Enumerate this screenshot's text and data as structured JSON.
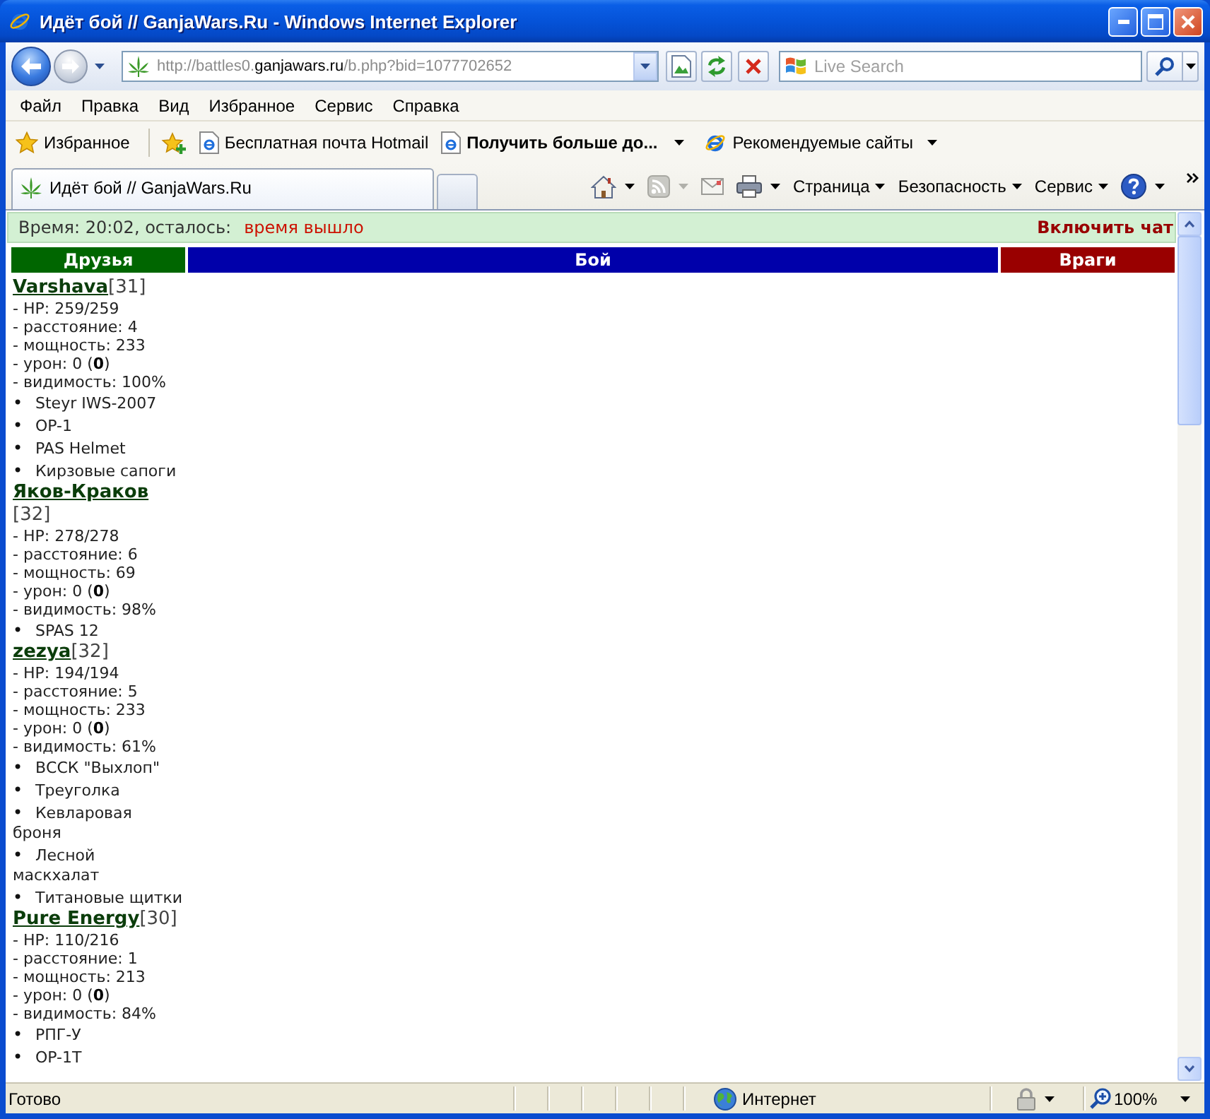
{
  "window": {
    "title": "Идёт бой // GanjaWars.Ru - Windows Internet Explorer"
  },
  "address_bar": {
    "url_start": "http://battles0.",
    "url_domain": "ganjawars.ru",
    "url_end": "/b.php?bid=1077702652"
  },
  "search": {
    "placeholder": "Live Search"
  },
  "menu": [
    "Файл",
    "Правка",
    "Вид",
    "Избранное",
    "Сервис",
    "Справка"
  ],
  "favorites_bar": {
    "favorites_label": "Избранное",
    "links": [
      {
        "kind": "link",
        "label": "Бесплатная почта Hotmail"
      },
      {
        "kind": "web_slice",
        "label": "Получить больше до..."
      },
      {
        "kind": "suggested",
        "label": "Рекомендуемые сайты"
      }
    ]
  },
  "tabs": [
    {
      "label": "Идёт бой // GanjaWars.Ru",
      "selected": true
    }
  ],
  "command_bar": {
    "feeds_disabled": true,
    "menus": [
      "Страница",
      "Безопасность",
      "Сервис"
    ]
  },
  "page": {
    "timer": {
      "label": "Время: 20:02, осталось:",
      "value": "время вышло"
    },
    "chat_link": "Включить чат",
    "columns": [
      {
        "label": "Друзья",
        "color": "#006600"
      },
      {
        "label": "Бой",
        "color": "#0000aa"
      },
      {
        "label": "Враги",
        "color": "#990000"
      }
    ],
    "friends": [
      {
        "name": "Varshava",
        "level": "[31]",
        "stats": [
          "- HP: 259/259",
          "- расстояние: 4",
          "- мощность: 233",
          "- урон: 0 (**0**)",
          "- видимость: 100%"
        ],
        "items": [
          {
            "marker": "•",
            "name": "Steyr IWS-2007"
          },
          {
            "marker": "•",
            "name": "OP-1"
          },
          {
            "marker": "•",
            "name": "PAS Helmet"
          },
          {
            "marker": "•",
            "name": "Кирзовые сапоги"
          }
        ]
      },
      {
        "name": "Яков-Краков",
        "level": "[32]",
        "stats": [
          "- HP: 278/278",
          "- расстояние: 6",
          "- мощность: 69",
          "- урон: 0 (**0**)",
          "- видимость: 98%"
        ],
        "items": [
          {
            "marker": "•",
            "name": "SPAS 12"
          }
        ]
      },
      {
        "name": "zezya",
        "level": "[32]",
        "stats": [
          "- HP: 194/194",
          "- расстояние: 5",
          "- мощность: 233",
          "- урон: 0 (**0**)",
          "- видимость: 61%"
        ],
        "items": [
          {
            "marker": "•",
            "name": "ВССК \"Выхлоп\""
          },
          {
            "marker": "•",
            "name": "Треуголка"
          },
          {
            "marker": "•",
            "name": "Кевларовая броня"
          },
          {
            "marker": "•",
            "name": "Лесной маскхалат"
          },
          {
            "marker": "•",
            "name": "Титановые щитки"
          }
        ]
      },
      {
        "name": "Pure Energy",
        "level": "[30]",
        "stats": [
          "- HP: 110/216",
          "- расстояние: 1",
          "- мощность: 213",
          "- урон: 0 (**0**)",
          "- видимость: 84%"
        ],
        "items": [
          {
            "marker": "•",
            "name": "РПГ-У"
          },
          {
            "marker": "•",
            "name": "OP-1T"
          }
        ]
      }
    ]
  },
  "status_bar": {
    "text": "Готово",
    "zone": "Интернет",
    "zoom": "100%"
  }
}
